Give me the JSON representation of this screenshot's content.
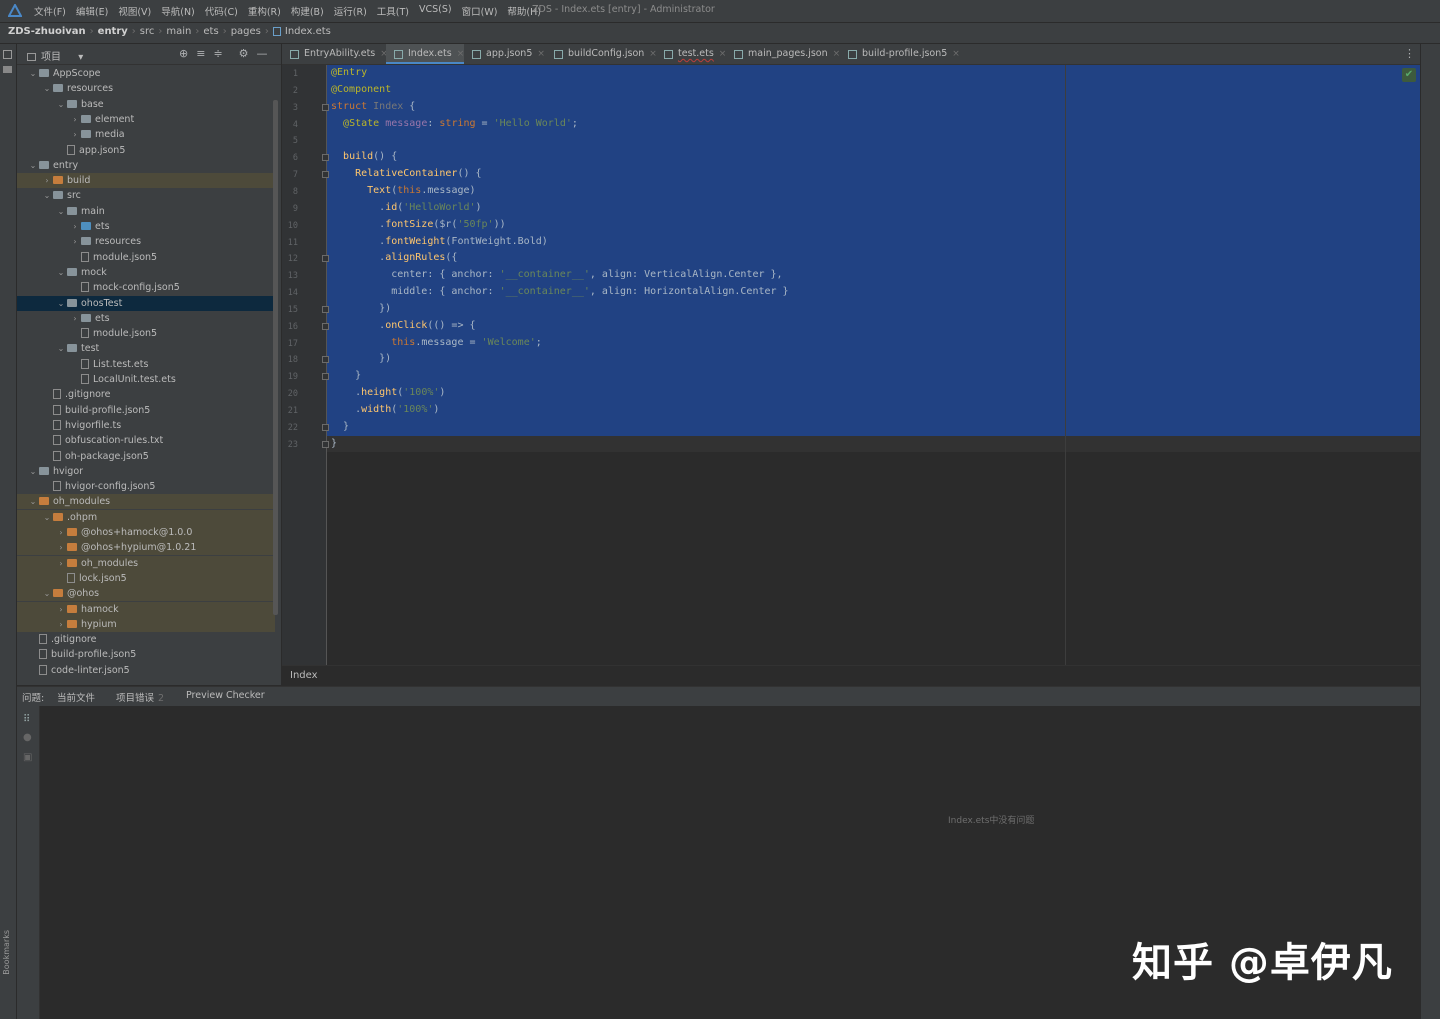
{
  "menubar": {
    "items": [
      "文件(F)",
      "编辑(E)",
      "视图(V)",
      "导航(N)",
      "代码(C)",
      "重构(R)",
      "构建(B)",
      "运行(R)",
      "工具(T)",
      "VCS(S)",
      "窗口(W)",
      "帮助(H)"
    ],
    "window_title": "ZDS - Index.ets [entry] - Administrator"
  },
  "breadcrumb": [
    "ZDS-zhuoivan",
    "entry",
    "src",
    "main",
    "ets",
    "pages",
    "Index.ets"
  ],
  "project_panel": {
    "title": "项目",
    "tree": [
      {
        "label": "AppScope",
        "depth": 1,
        "open": true,
        "kind": "folder"
      },
      {
        "label": "resources",
        "depth": 2,
        "open": true,
        "kind": "folder"
      },
      {
        "label": "base",
        "depth": 3,
        "open": true,
        "kind": "folder"
      },
      {
        "label": "element",
        "depth": 4,
        "open": false,
        "kind": "folder"
      },
      {
        "label": "media",
        "depth": 4,
        "open": false,
        "kind": "folder"
      },
      {
        "label": "app.json5",
        "depth": 3,
        "kind": "file"
      },
      {
        "label": "entry",
        "depth": 1,
        "open": true,
        "kind": "folder"
      },
      {
        "label": "build",
        "depth": 2,
        "open": false,
        "kind": "folder-orange",
        "hl": true
      },
      {
        "label": "src",
        "depth": 2,
        "open": true,
        "kind": "folder"
      },
      {
        "label": "main",
        "depth": 3,
        "open": true,
        "kind": "folder"
      },
      {
        "label": "ets",
        "depth": 4,
        "open": false,
        "kind": "folder-blue"
      },
      {
        "label": "resources",
        "depth": 4,
        "open": false,
        "kind": "folder"
      },
      {
        "label": "module.json5",
        "depth": 4,
        "kind": "file"
      },
      {
        "label": "mock",
        "depth": 3,
        "open": true,
        "kind": "folder"
      },
      {
        "label": "mock-config.json5",
        "depth": 4,
        "kind": "file"
      },
      {
        "label": "ohosTest",
        "depth": 3,
        "open": true,
        "kind": "folder",
        "sel": true
      },
      {
        "label": "ets",
        "depth": 4,
        "open": false,
        "kind": "folder"
      },
      {
        "label": "module.json5",
        "depth": 4,
        "kind": "file"
      },
      {
        "label": "test",
        "depth": 3,
        "open": true,
        "kind": "folder"
      },
      {
        "label": "List.test.ets",
        "depth": 4,
        "kind": "file"
      },
      {
        "label": "LocalUnit.test.ets",
        "depth": 4,
        "kind": "file"
      },
      {
        "label": ".gitignore",
        "depth": 2,
        "kind": "file"
      },
      {
        "label": "build-profile.json5",
        "depth": 2,
        "kind": "file"
      },
      {
        "label": "hvigorfile.ts",
        "depth": 2,
        "kind": "file"
      },
      {
        "label": "obfuscation-rules.txt",
        "depth": 2,
        "kind": "file"
      },
      {
        "label": "oh-package.json5",
        "depth": 2,
        "kind": "file"
      },
      {
        "label": "hvigor",
        "depth": 1,
        "open": true,
        "kind": "folder"
      },
      {
        "label": "hvigor-config.json5",
        "depth": 2,
        "kind": "file"
      },
      {
        "label": "oh_modules",
        "depth": 1,
        "open": true,
        "kind": "folder-orange",
        "hl": true
      },
      {
        "label": ".ohpm",
        "depth": 2,
        "open": true,
        "kind": "folder-orange",
        "hl": true
      },
      {
        "label": "@ohos+hamock@1.0.0",
        "depth": 3,
        "open": false,
        "kind": "folder-orange",
        "hl": true
      },
      {
        "label": "@ohos+hypium@1.0.21",
        "depth": 3,
        "open": false,
        "kind": "folder-orange",
        "hl": true
      },
      {
        "label": "oh_modules",
        "depth": 3,
        "open": false,
        "kind": "folder-orange",
        "hl": true
      },
      {
        "label": "lock.json5",
        "depth": 3,
        "kind": "file",
        "hl": true
      },
      {
        "label": "@ohos",
        "depth": 2,
        "open": true,
        "kind": "folder-orange",
        "hl": true
      },
      {
        "label": "hamock",
        "depth": 3,
        "open": false,
        "kind": "folder-orange",
        "hl": true
      },
      {
        "label": "hypium",
        "depth": 3,
        "open": false,
        "kind": "folder-orange",
        "hl": true
      },
      {
        "label": ".gitignore",
        "depth": 1,
        "kind": "file"
      },
      {
        "label": "build-profile.json5",
        "depth": 1,
        "kind": "file"
      },
      {
        "label": "code-linter.json5",
        "depth": 1,
        "kind": "file"
      }
    ]
  },
  "tabs": [
    {
      "label": "EntryAbility.ets",
      "active": false,
      "error": false
    },
    {
      "label": "Index.ets",
      "active": true,
      "error": false
    },
    {
      "label": "app.json5",
      "active": false,
      "error": false
    },
    {
      "label": "buildConfig.json",
      "active": false,
      "error": false
    },
    {
      "label": "test.ets",
      "active": false,
      "error": true
    },
    {
      "label": "main_pages.json",
      "active": false,
      "error": false
    },
    {
      "label": "build-profile.json5",
      "active": false,
      "error": false
    }
  ],
  "editor": {
    "line_count": 23,
    "breadcrumb": "Index",
    "code": [
      [
        [
          "a",
          "@Entry"
        ]
      ],
      [
        [
          "a",
          "@Component"
        ]
      ],
      [
        [
          "k",
          "struct "
        ],
        [
          "g",
          "Index"
        ],
        [
          "t",
          " {"
        ]
      ],
      [
        [
          "t",
          "  "
        ],
        [
          "a",
          "@State "
        ],
        [
          "p",
          "message"
        ],
        [
          "t",
          ": "
        ],
        [
          "k",
          "string"
        ],
        [
          "t",
          " = "
        ],
        [
          "s",
          "'Hello World'"
        ],
        [
          "t",
          ";"
        ]
      ],
      [],
      [
        [
          "t",
          "  "
        ],
        [
          "f",
          "build"
        ],
        [
          "t",
          "() {"
        ]
      ],
      [
        [
          "t",
          "    "
        ],
        [
          "f",
          "RelativeContainer"
        ],
        [
          "t",
          "() {"
        ]
      ],
      [
        [
          "t",
          "      "
        ],
        [
          "f",
          "Text"
        ],
        [
          "t",
          "("
        ],
        [
          "k",
          "this"
        ],
        [
          "t",
          ".message)"
        ]
      ],
      [
        [
          "t",
          "        ."
        ],
        [
          "f",
          "id"
        ],
        [
          "t",
          "("
        ],
        [
          "s",
          "'HelloWorld'"
        ],
        [
          "t",
          ")"
        ]
      ],
      [
        [
          "t",
          "        ."
        ],
        [
          "f",
          "fontSize"
        ],
        [
          "t",
          "($r("
        ],
        [
          "s",
          "'50fp'"
        ],
        [
          "t",
          "))"
        ]
      ],
      [
        [
          "t",
          "        ."
        ],
        [
          "f",
          "fontWeight"
        ],
        [
          "t",
          "(FontWeight.Bold)"
        ]
      ],
      [
        [
          "t",
          "        ."
        ],
        [
          "f",
          "alignRules"
        ],
        [
          "t",
          "({"
        ]
      ],
      [
        [
          "t",
          "          center: { anchor: "
        ],
        [
          "s",
          "'__container__'"
        ],
        [
          "t",
          ", align: VerticalAlign.Center },"
        ]
      ],
      [
        [
          "t",
          "          middle: { anchor: "
        ],
        [
          "s",
          "'__container__'"
        ],
        [
          "t",
          ", align: HorizontalAlign.Center }"
        ]
      ],
      [
        [
          "t",
          "        })"
        ]
      ],
      [
        [
          "t",
          "        ."
        ],
        [
          "f",
          "onClick"
        ],
        [
          "t",
          "(() => {"
        ]
      ],
      [
        [
          "t",
          "          "
        ],
        [
          "k",
          "this"
        ],
        [
          "t",
          ".message = "
        ],
        [
          "s",
          "'Welcome'"
        ],
        [
          "t",
          ";"
        ]
      ],
      [
        [
          "t",
          "        })"
        ]
      ],
      [
        [
          "t",
          "    }"
        ]
      ],
      [
        [
          "t",
          "    ."
        ],
        [
          "f",
          "height"
        ],
        [
          "t",
          "("
        ],
        [
          "s",
          "'100%'"
        ],
        [
          "t",
          ")"
        ]
      ],
      [
        [
          "t",
          "    ."
        ],
        [
          "f",
          "width"
        ],
        [
          "t",
          "("
        ],
        [
          "s",
          "'100%'"
        ],
        [
          "t",
          ")"
        ]
      ],
      [
        [
          "t",
          "  }"
        ]
      ],
      [
        [
          "t",
          "}"
        ]
      ]
    ]
  },
  "problems": {
    "label": "问题:",
    "tabs": [
      {
        "label": "当前文件",
        "count": "",
        "active": true
      },
      {
        "label": "项目错误",
        "count": "2",
        "active": false
      },
      {
        "label": "Preview Checker",
        "count": "",
        "active": false
      }
    ],
    "empty_message": "Index.ets中没有问题"
  },
  "watermark": "知乎 @卓伊凡",
  "side_labels": {
    "bookmarks": "Bookmarks"
  }
}
